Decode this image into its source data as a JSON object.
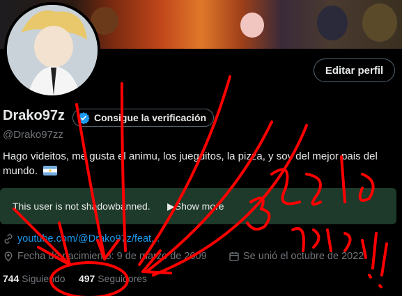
{
  "profile": {
    "display_name": "Drako97z",
    "verify_label": "Consigue la verificación",
    "handle": "@Drako97zz",
    "bio": "Hago videitos, me gusta el animu, los jueguitos, la pizza, y soy del mejor pais del mundo.",
    "edit_label": "Editar perfil"
  },
  "shadowban_banner": {
    "text": "This user is not shadowbanned.",
    "show_more": "▶Show more"
  },
  "meta": {
    "link": "youtube.com/@Drako97z/feat...",
    "birth": "Fecha de nacimiento: 9 de marzo de 2009",
    "joined": "Se unió el octubre de 2022"
  },
  "stats": {
    "following_count": "744",
    "following_label": "Siguiendo",
    "followers_count": "497",
    "followers_label": "Seguidores"
  },
  "colors": {
    "background": "#000000",
    "link": "#1d9bf0",
    "verify_badge": "#1d9bf0",
    "banner_box": "#1e3a2a",
    "scribble": "#ff0000"
  },
  "icons": [
    "verified-badge-icon",
    "link-icon",
    "location-pin-icon",
    "calendar-icon",
    "argentina-flag-icon"
  ]
}
